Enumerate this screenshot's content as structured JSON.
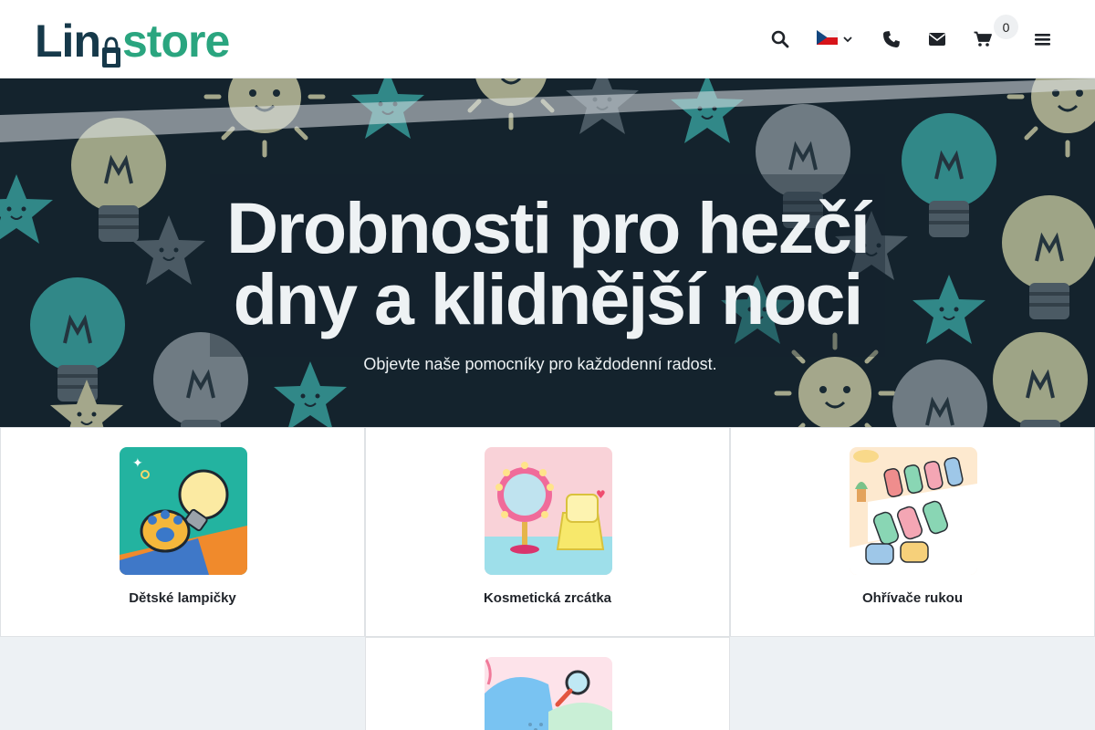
{
  "header": {
    "logo": {
      "part1": "Li",
      "part2": "n",
      "part3": "store"
    },
    "icons": [
      "search-icon",
      "flag-cz-icon",
      "chevron-down-icon",
      "phone-icon",
      "envelope-icon",
      "cart-icon",
      "hamburger-menu-icon"
    ],
    "cart_count": "0"
  },
  "hero": {
    "title_line1": "Drobnosti pro hezčí",
    "title_line2": "dny a klidnější noci",
    "subtitle": "Objevte naše pomocníky pro každodenní radost."
  },
  "categories": [
    {
      "label": "Dětské lampičky"
    },
    {
      "label": "Kosmetická zrcátka"
    },
    {
      "label": "Ohřívače rukou"
    },
    {
      "label": ""
    }
  ],
  "colors": {
    "brand_dark": "#16394a",
    "brand_green": "#2aa57f",
    "hero_bg": "#14232d",
    "teal": "#3aa6a3",
    "filler": "#edf1f4"
  }
}
